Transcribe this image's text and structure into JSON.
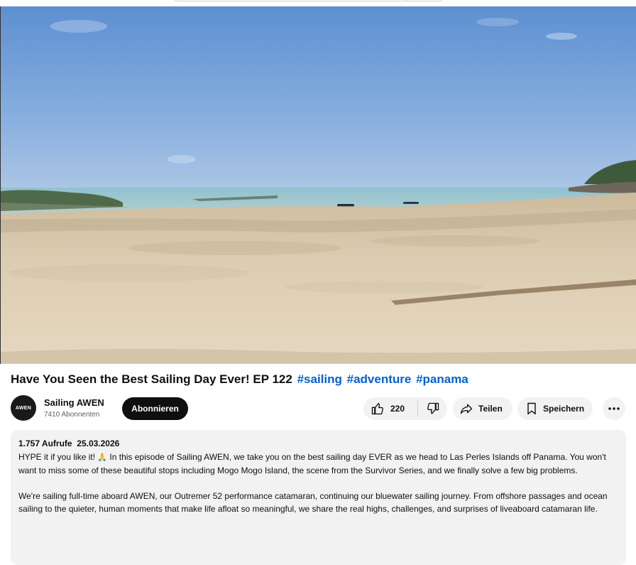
{
  "video": {
    "title": "Have You Seen the Best Sailing Day Ever! EP 122",
    "hashtags": [
      "#sailing",
      "#adventure",
      "#panama"
    ]
  },
  "channel": {
    "avatar_text": "AWEN",
    "name": "Sailing AWEN",
    "subscribers": "7410 Abonnenten",
    "subscribe_label": "Abonnieren"
  },
  "actions": {
    "like_count": "220",
    "share_label": "Teilen",
    "save_label": "Speichern"
  },
  "description": {
    "views": "1.757 Aufrufe",
    "date": "25.03.2026",
    "paragraph1_a": "HYPE it if you like it! ",
    "emoji": "🙏",
    "paragraph1_b": " In this episode of Sailing AWEN, we take you on the best sailing day EVER as we head to Las Perles Islands off Panama. You won't want to miss some of these beautiful stops including Mogo Mogo Island, the scene from the Survivor Series, and we finally solve a few big problems.",
    "paragraph2": "We're sailing full-time aboard AWEN, our Outremer 52 performance catamaran, continuing our bluewater sailing journey. From offshore passages and ocean sailing to the quieter, human moments that make life afloat so meaningful, we share the real highs, challenges, and surprises of liveaboard catamaran life."
  },
  "icons": {
    "like": "thumbs-up-icon",
    "dislike": "thumbs-down-icon",
    "share": "share-arrow-icon",
    "save": "bookmark-icon",
    "more": "more-horizontal-icon"
  }
}
